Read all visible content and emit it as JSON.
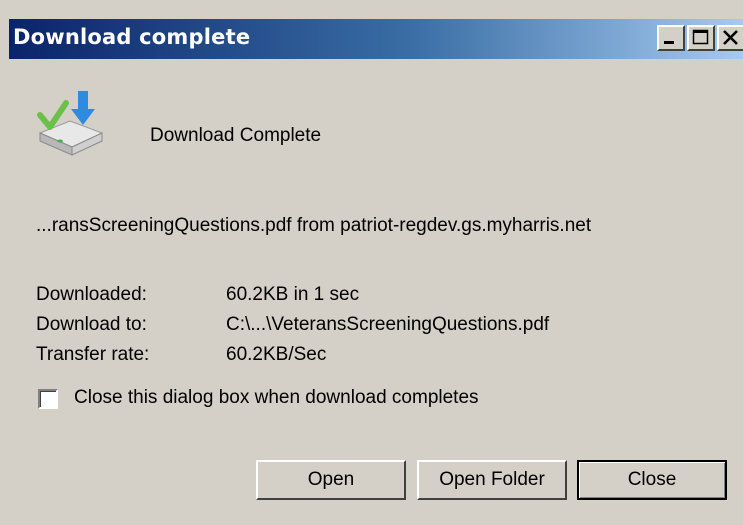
{
  "window": {
    "title": "Download complete"
  },
  "titlebar_buttons": {
    "minimize_icon": "minimize-icon",
    "maximize_icon": "maximize-icon",
    "close_icon": "close-x-icon"
  },
  "main": {
    "icon": "download-complete-icon",
    "headline": "Download Complete",
    "filename": "...ransScreeningQuestions.pdf from patriot-regdev.gs.myharris.net"
  },
  "details": [
    {
      "label": "Downloaded:",
      "value": "60.2KB in 1 sec"
    },
    {
      "label": "Download to:",
      "value": "C:\\...\\VeteransScreeningQuestions.pdf"
    },
    {
      "label": "Transfer rate:",
      "value": "60.2KB/Sec"
    }
  ],
  "checkbox": {
    "label": "Close this dialog box when download completes",
    "checked": false
  },
  "buttons": {
    "open": "Open",
    "open_folder": "Open Folder",
    "close": "Close"
  }
}
